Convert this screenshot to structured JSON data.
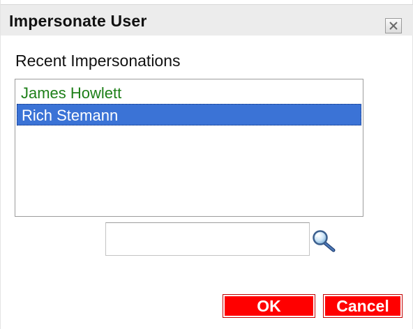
{
  "dialog": {
    "title": "Impersonate User",
    "close_icon": "close-icon"
  },
  "recent": {
    "label": "Recent Impersonations",
    "items": [
      {
        "name": "James Howlett",
        "selected": false
      },
      {
        "name": "Rich Stemann",
        "selected": true
      }
    ]
  },
  "search": {
    "value": "",
    "placeholder": "",
    "icon": "magnifier-icon"
  },
  "buttons": {
    "ok_label": "OK",
    "cancel_label": "Cancel"
  },
  "colors": {
    "selection": "#3b73d6",
    "item_text": "#1d7f18",
    "button": "#ff0000"
  }
}
